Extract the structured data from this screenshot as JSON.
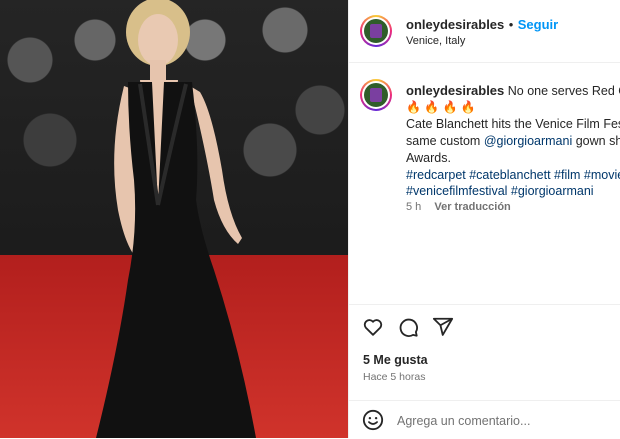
{
  "post": {
    "image_alt": "Cate Blanchett in a black Giorgio Armani gown on the red carpet at the Venice Film Festival",
    "author": "onleydesirables",
    "dot": "•",
    "follow_label": "Seguir",
    "location": "Venice, Italy"
  },
  "caption": {
    "author": "onleydesirables",
    "text_1": "No one serves Red Car",
    "emojis": "🔥 🔥 🔥 🔥",
    "line_3": "Cate Blanchett hits the Venice Film Festi",
    "line_4_pre": "same custom ",
    "line_4_mention": "@giorgioarmani",
    "line_4_post": " gown sh",
    "line_5": "Awards.",
    "tags_1": "#redcarpet #cateblanchett #film #movie",
    "tags_2": "#venicefilmfestival #giorgioarmani",
    "time": "5 h",
    "translate": "Ver traducción"
  },
  "actions": {
    "like_icon": "heart-icon",
    "comment_icon": "comment-icon",
    "share_icon": "send-icon"
  },
  "likes": "5 Me gusta",
  "posted_ago": "Hace 5 horas",
  "comment_box": {
    "emoji_icon": "smiley-icon",
    "placeholder": "Agrega un comentario..."
  }
}
